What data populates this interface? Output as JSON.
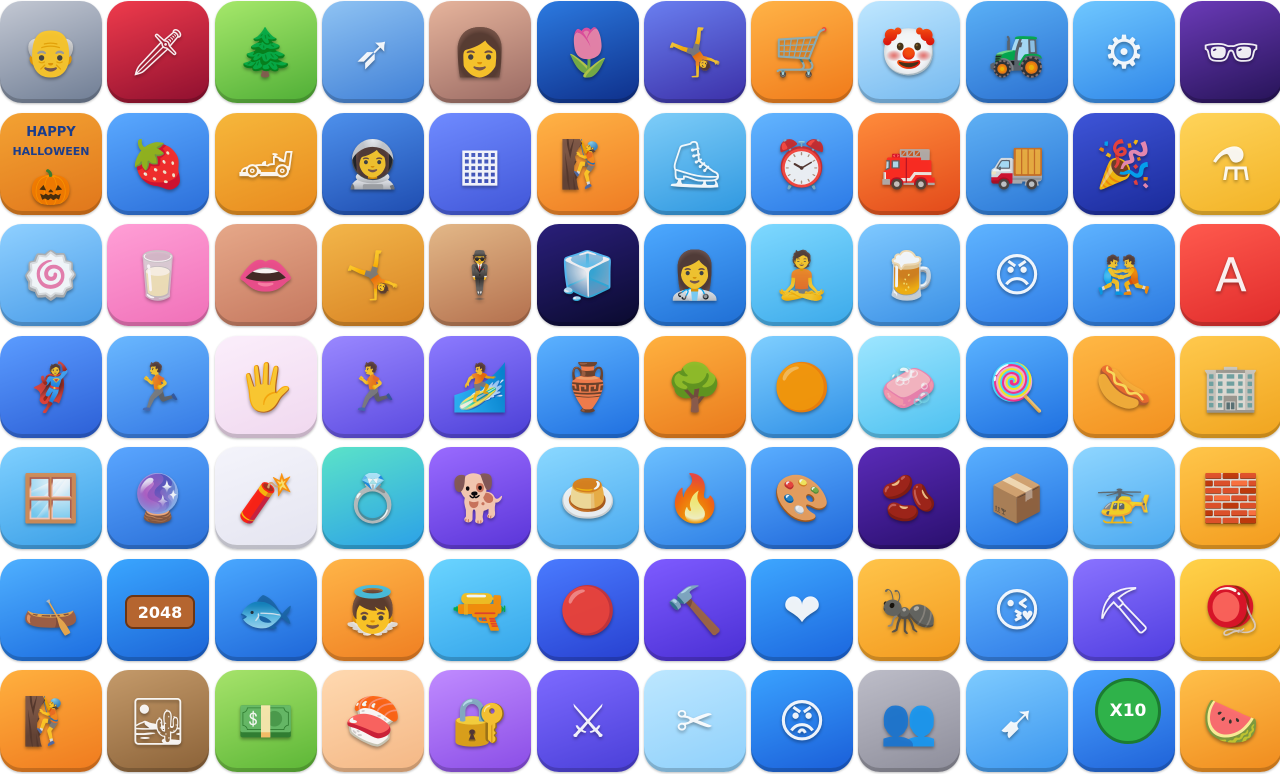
{
  "icons": [
    {
      "name": "grandpa-icon",
      "glyph": "👴",
      "colors": [
        "#c3c8d3",
        "#6f7d94"
      ]
    },
    {
      "name": "sword-icon",
      "glyph": "🗡",
      "colors": [
        "#ef3b4c",
        "#8e0f2f"
      ]
    },
    {
      "name": "seesaw-icon",
      "glyph": "🌲",
      "colors": [
        "#a6e86b",
        "#4fae36"
      ]
    },
    {
      "name": "arrow-icon",
      "glyph": "➶",
      "colors": [
        "#8fc3f3",
        "#3f7fd6"
      ]
    },
    {
      "name": "woman-portrait-icon",
      "glyph": "👩",
      "colors": [
        "#e6b49c",
        "#9a6a63"
      ]
    },
    {
      "name": "tulip-icon",
      "glyph": "🌷",
      "colors": [
        "#2c7ae0",
        "#0e2f8a"
      ]
    },
    {
      "name": "tightrope-icon",
      "glyph": "🤸",
      "colors": [
        "#6a7ff0",
        "#3b2fa7"
      ]
    },
    {
      "name": "shopping-cart-icon",
      "glyph": "🛒",
      "colors": [
        "#ffb347",
        "#f07a1a"
      ]
    },
    {
      "name": "unicycle-clown-icon",
      "glyph": "🤡",
      "colors": [
        "#bfe7ff",
        "#74b8ef"
      ]
    },
    {
      "name": "bulldozer-icon",
      "glyph": "🚜",
      "colors": [
        "#5ab0f6",
        "#2a6fd0"
      ]
    },
    {
      "name": "drill-icon",
      "glyph": "⚙",
      "colors": [
        "#6fc7ff",
        "#2f86e8"
      ]
    },
    {
      "name": "spy-runner-icon",
      "glyph": "🕶",
      "colors": [
        "#6b3bb8",
        "#261357"
      ]
    },
    {
      "name": "halloween-icon",
      "glyph": "🎃",
      "colors": [
        "#f3a233",
        "#e0761b"
      ],
      "line1": "HAPPY",
      "line2": "HALLOWEEN"
    },
    {
      "name": "magnifier-fruit-icon",
      "glyph": "🍓",
      "colors": [
        "#5aa9ff",
        "#2b6ed9"
      ]
    },
    {
      "name": "race-cars-icon",
      "glyph": "🏎",
      "colors": [
        "#f6b73b",
        "#e88a1e"
      ]
    },
    {
      "name": "astronaut-icon",
      "glyph": "👩‍🚀",
      "colors": [
        "#4e91ec",
        "#1e4cb0"
      ]
    },
    {
      "name": "blocks-icon",
      "glyph": "▦",
      "colors": [
        "#6f8bff",
        "#4156d8"
      ]
    },
    {
      "name": "rope-climber-icon",
      "glyph": "🧗",
      "colors": [
        "#ffb346",
        "#ee7b23"
      ]
    },
    {
      "name": "ice-skate-icon",
      "glyph": "⛸",
      "colors": [
        "#7ecdf8",
        "#2e97e0"
      ]
    },
    {
      "name": "alarm-clock-icon",
      "glyph": "⏰",
      "colors": [
        "#63b5ff",
        "#2b79e6"
      ]
    },
    {
      "name": "firefighter-icon",
      "glyph": "🚒",
      "colors": [
        "#ff8c3b",
        "#e2491a"
      ]
    },
    {
      "name": "moving-truck-icon",
      "glyph": "🚚",
      "colors": [
        "#5fb0f4",
        "#2a76d6"
      ]
    },
    {
      "name": "party-popper-icon",
      "glyph": "🎉",
      "colors": [
        "#3e55d8",
        "#1a2a9a"
      ]
    },
    {
      "name": "potion-icon",
      "glyph": "⚗",
      "colors": [
        "#ffd45a",
        "#f2b226"
      ]
    },
    {
      "name": "cinnamon-roll-icon",
      "glyph": "🍥",
      "colors": [
        "#8fd0ff",
        "#4a9ce8"
      ]
    },
    {
      "name": "slime-icon",
      "glyph": "🥛",
      "colors": [
        "#ff9fd6",
        "#f070b8"
      ]
    },
    {
      "name": "lips-filler-icon",
      "glyph": "👄",
      "colors": [
        "#e6a889",
        "#c5785f"
      ]
    },
    {
      "name": "gymnast-rings-icon",
      "glyph": "🤸",
      "colors": [
        "#f3b64a",
        "#d88323"
      ]
    },
    {
      "name": "couple-icon",
      "glyph": "🕴",
      "colors": [
        "#e3b888",
        "#b36f4d"
      ]
    },
    {
      "name": "neon-cube-icon",
      "glyph": "🧊",
      "colors": [
        "#2a1f7a",
        "#0a0a2e"
      ]
    },
    {
      "name": "doctor-icon",
      "glyph": "👩‍⚕",
      "colors": [
        "#4da9ff",
        "#1f6ed4"
      ]
    },
    {
      "name": "yoga-icon",
      "glyph": "🧘",
      "colors": [
        "#7fd9ff",
        "#3ba9ea"
      ]
    },
    {
      "name": "waitress-icon",
      "glyph": "🍺",
      "colors": [
        "#7fc9ff",
        "#3a8fe5"
      ]
    },
    {
      "name": "angry-man-icon",
      "glyph": "😠",
      "colors": [
        "#5fb4ff",
        "#2f7ce6"
      ]
    },
    {
      "name": "tug-of-war-icon",
      "glyph": "🤼",
      "colors": [
        "#5eb3ff",
        "#2b79e0"
      ]
    },
    {
      "name": "letter-runner-icon",
      "glyph": "A",
      "colors": [
        "#ff5a4e",
        "#e02b2b"
      ]
    },
    {
      "name": "hero-punch-icon",
      "glyph": "🦸",
      "colors": [
        "#5b9cff",
        "#2c5fd6"
      ]
    },
    {
      "name": "jump-runner-icon",
      "glyph": "🏃",
      "colors": [
        "#6ab8ff",
        "#3478e4"
      ]
    },
    {
      "name": "hand-prints-icon",
      "glyph": "🖐",
      "colors": [
        "#fbeefb",
        "#f0d8ef"
      ]
    },
    {
      "name": "crowd-push-icon",
      "glyph": "🏃",
      "colors": [
        "#9a88ff",
        "#5b4ae0"
      ]
    },
    {
      "name": "water-slide-icon",
      "glyph": "🏄",
      "colors": [
        "#8d7bff",
        "#4b3fd6"
      ]
    },
    {
      "name": "pottery-icon",
      "glyph": "🏺",
      "colors": [
        "#5cb2ff",
        "#1f6fe0"
      ]
    },
    {
      "name": "chainsaw-tree-icon",
      "glyph": "🌳",
      "colors": [
        "#ffb13f",
        "#e97a1d"
      ]
    },
    {
      "name": "glass-smash-icon",
      "glyph": "🟠",
      "colors": [
        "#7fcfff",
        "#2f8fe6"
      ]
    },
    {
      "name": "soap-cut-icon",
      "glyph": "🧼",
      "colors": [
        "#9ee6ff",
        "#4cc0f0"
      ]
    },
    {
      "name": "lollipop-icon",
      "glyph": "🍭",
      "colors": [
        "#5ab2ff",
        "#1e6fe0"
      ]
    },
    {
      "name": "sausage-fork-icon",
      "glyph": "🌭",
      "colors": [
        "#ffb845",
        "#f2901f"
      ]
    },
    {
      "name": "tower-stack-icon",
      "glyph": "🏢",
      "colors": [
        "#ffc94d",
        "#f0a41f"
      ]
    },
    {
      "name": "squeegee-icon",
      "glyph": "🪟",
      "colors": [
        "#7fd0ff",
        "#3a9ee6"
      ]
    },
    {
      "name": "crystal-ball-icon",
      "glyph": "🔮",
      "colors": [
        "#5aa6ff",
        "#2a6fd8"
      ]
    },
    {
      "name": "rope-cut-icon",
      "glyph": "🧨",
      "colors": [
        "#f4f4fb",
        "#e4e4f0"
      ]
    },
    {
      "name": "ring-slice-icon",
      "glyph": "💍",
      "colors": [
        "#5be3c8",
        "#2ba0e8"
      ]
    },
    {
      "name": "dog-grooming-icon",
      "glyph": "🐕",
      "colors": [
        "#9a6bff",
        "#5a35d8"
      ]
    },
    {
      "name": "jelly-drop-icon",
      "glyph": "🍮",
      "colors": [
        "#8ad8ff",
        "#4aa9ef"
      ]
    },
    {
      "name": "rope-fire-icon",
      "glyph": "🔥",
      "colors": [
        "#6cc0ff",
        "#2e7fe6"
      ]
    },
    {
      "name": "paint-tile-icon",
      "glyph": "🎨",
      "colors": [
        "#5aaeff",
        "#2068da"
      ]
    },
    {
      "name": "jelly-bean-icon",
      "glyph": "🫘",
      "colors": [
        "#5a2bb8",
        "#2a0f6e"
      ]
    },
    {
      "name": "forklift-crates-icon",
      "glyph": "📦",
      "colors": [
        "#5ab0ff",
        "#2270e0"
      ]
    },
    {
      "name": "helicopter-icon",
      "glyph": "🚁",
      "colors": [
        "#8fd6ff",
        "#4aa8f0"
      ]
    },
    {
      "name": "builder-runner-icon",
      "glyph": "🧱",
      "colors": [
        "#ffc64a",
        "#f39b1e"
      ]
    },
    {
      "name": "kayak-icon",
      "glyph": "🛶",
      "colors": [
        "#4fb0ff",
        "#1c6de0"
      ]
    },
    {
      "name": "hex-2048-icon",
      "glyph": "",
      "colors": [
        "#3aa6ff",
        "#1b63d6"
      ],
      "badge": "2048"
    },
    {
      "name": "fish-cutting-icon",
      "glyph": "🐟",
      "colors": [
        "#4aa8ff",
        "#1e66d8"
      ]
    },
    {
      "name": "angel-crowd-icon",
      "glyph": "👼",
      "colors": [
        "#ffb548",
        "#ef7f22"
      ]
    },
    {
      "name": "spy-woman-icon",
      "glyph": "🔫",
      "colors": [
        "#6ad4ff",
        "#34a4ea"
      ]
    },
    {
      "name": "pinball-icon",
      "glyph": "🔴",
      "colors": [
        "#4a7bff",
        "#2740d0"
      ]
    },
    {
      "name": "hammer-man-icon",
      "glyph": "🔨",
      "colors": [
        "#7e5bff",
        "#4a2fd4"
      ]
    },
    {
      "name": "pixel-heart-icon",
      "glyph": "❤",
      "colors": [
        "#3ea7ff",
        "#1b66de"
      ]
    },
    {
      "name": "ant-icon",
      "glyph": "🐜",
      "colors": [
        "#ffc44a",
        "#f39a1f"
      ]
    },
    {
      "name": "kiss-emoji-icon",
      "glyph": "😘",
      "colors": [
        "#62b8ff",
        "#2f7ae6"
      ]
    },
    {
      "name": "digger-icon",
      "glyph": "⛏",
      "colors": [
        "#8a73ff",
        "#4f3de0"
      ]
    },
    {
      "name": "yoyo-icon",
      "glyph": "🪀",
      "colors": [
        "#ffd24a",
        "#f4a51f"
      ]
    },
    {
      "name": "rope-swing-icon",
      "glyph": "🧗",
      "colors": [
        "#ffb03f",
        "#ef7a1e"
      ]
    },
    {
      "name": "sand-cubes-icon",
      "glyph": "🏜",
      "colors": [
        "#c49a6a",
        "#8b6238"
      ]
    },
    {
      "name": "money-man-icon",
      "glyph": "💵",
      "colors": [
        "#a6e36b",
        "#5cb636"
      ]
    },
    {
      "name": "sushi-icon",
      "glyph": "🍣",
      "colors": [
        "#ffd9b0",
        "#f4b785"
      ]
    },
    {
      "name": "safe-icon",
      "glyph": "🔐",
      "colors": [
        "#c08bff",
        "#8a4de6"
      ]
    },
    {
      "name": "sword-runner-icon",
      "glyph": "⚔",
      "colors": [
        "#7d6aff",
        "#4a3fd8"
      ]
    },
    {
      "name": "scissors-icon",
      "glyph": "✂",
      "colors": [
        "#bde7ff",
        "#8fd0fb"
      ]
    },
    {
      "name": "angry-ball-runner-icon",
      "glyph": "😡",
      "colors": [
        "#3aa2ff",
        "#1a5ed8"
      ]
    },
    {
      "name": "crowd-maze-icon",
      "glyph": "👥",
      "colors": [
        "#bdbdc8",
        "#8d8d9a"
      ]
    },
    {
      "name": "slope-arrow-icon",
      "glyph": "➹",
      "colors": [
        "#7ecbff",
        "#3b95ee"
      ]
    },
    {
      "name": "multiplier-balls-icon",
      "glyph": "",
      "colors": [
        "#4aa2ff",
        "#1f62d8"
      ],
      "badge": "X10"
    },
    {
      "name": "ninja-fruit-icon",
      "glyph": "🍉",
      "colors": [
        "#ffc04a",
        "#f08b1e"
      ]
    }
  ]
}
